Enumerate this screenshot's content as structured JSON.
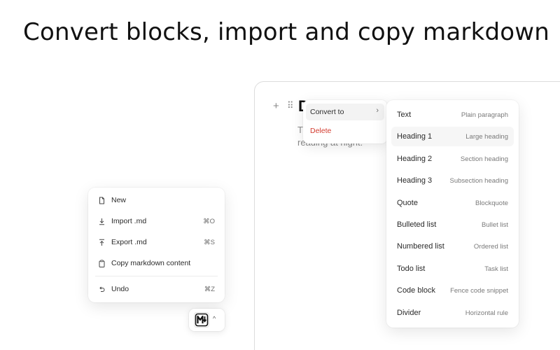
{
  "headline": "Convert blocks, import and copy markdown",
  "editor": {
    "plus_glyph": "+",
    "drag_glyph": "⠿",
    "heading_char": "D",
    "text_line1": "T",
    "text_line2": "reading at night."
  },
  "block_menu": {
    "convert_label": "Convert to",
    "convert_chevron": "›",
    "delete_label": "Delete",
    "delete_color": "#d33b2f"
  },
  "convert_submenu": {
    "items": [
      {
        "label": "Text",
        "description": "Plain paragraph",
        "active": false
      },
      {
        "label": "Heading 1",
        "description": "Large heading",
        "active": true
      },
      {
        "label": "Heading 2",
        "description": "Section heading",
        "active": false
      },
      {
        "label": "Heading 3",
        "description": "Subsection heading",
        "active": false
      },
      {
        "label": "Quote",
        "description": "Blockquote",
        "active": false
      },
      {
        "label": "Bulleted list",
        "description": "Bullet list",
        "active": false
      },
      {
        "label": "Numbered list",
        "description": "Ordered list",
        "active": false
      },
      {
        "label": "Todo list",
        "description": "Task list",
        "active": false
      },
      {
        "label": "Code block",
        "description": "Fence code snippet",
        "active": false
      },
      {
        "label": "Divider",
        "description": "Horizontal rule",
        "active": false
      }
    ]
  },
  "file_menu": {
    "items": [
      {
        "label": "New",
        "shortcut": "",
        "icon": "file-icon"
      },
      {
        "label": "Import .md",
        "shortcut": "⌘O",
        "icon": "download-icon"
      },
      {
        "label": "Export .md",
        "shortcut": "⌘S",
        "icon": "upload-icon"
      },
      {
        "label": "Copy markdown content",
        "shortcut": "",
        "icon": "clipboard-icon"
      },
      {
        "label": "Undo",
        "shortcut": "⌘Z",
        "icon": "undo-icon"
      }
    ]
  },
  "app_badge": {
    "logo_icon": "markdown-app-logo-icon",
    "caret_glyph": "^"
  }
}
